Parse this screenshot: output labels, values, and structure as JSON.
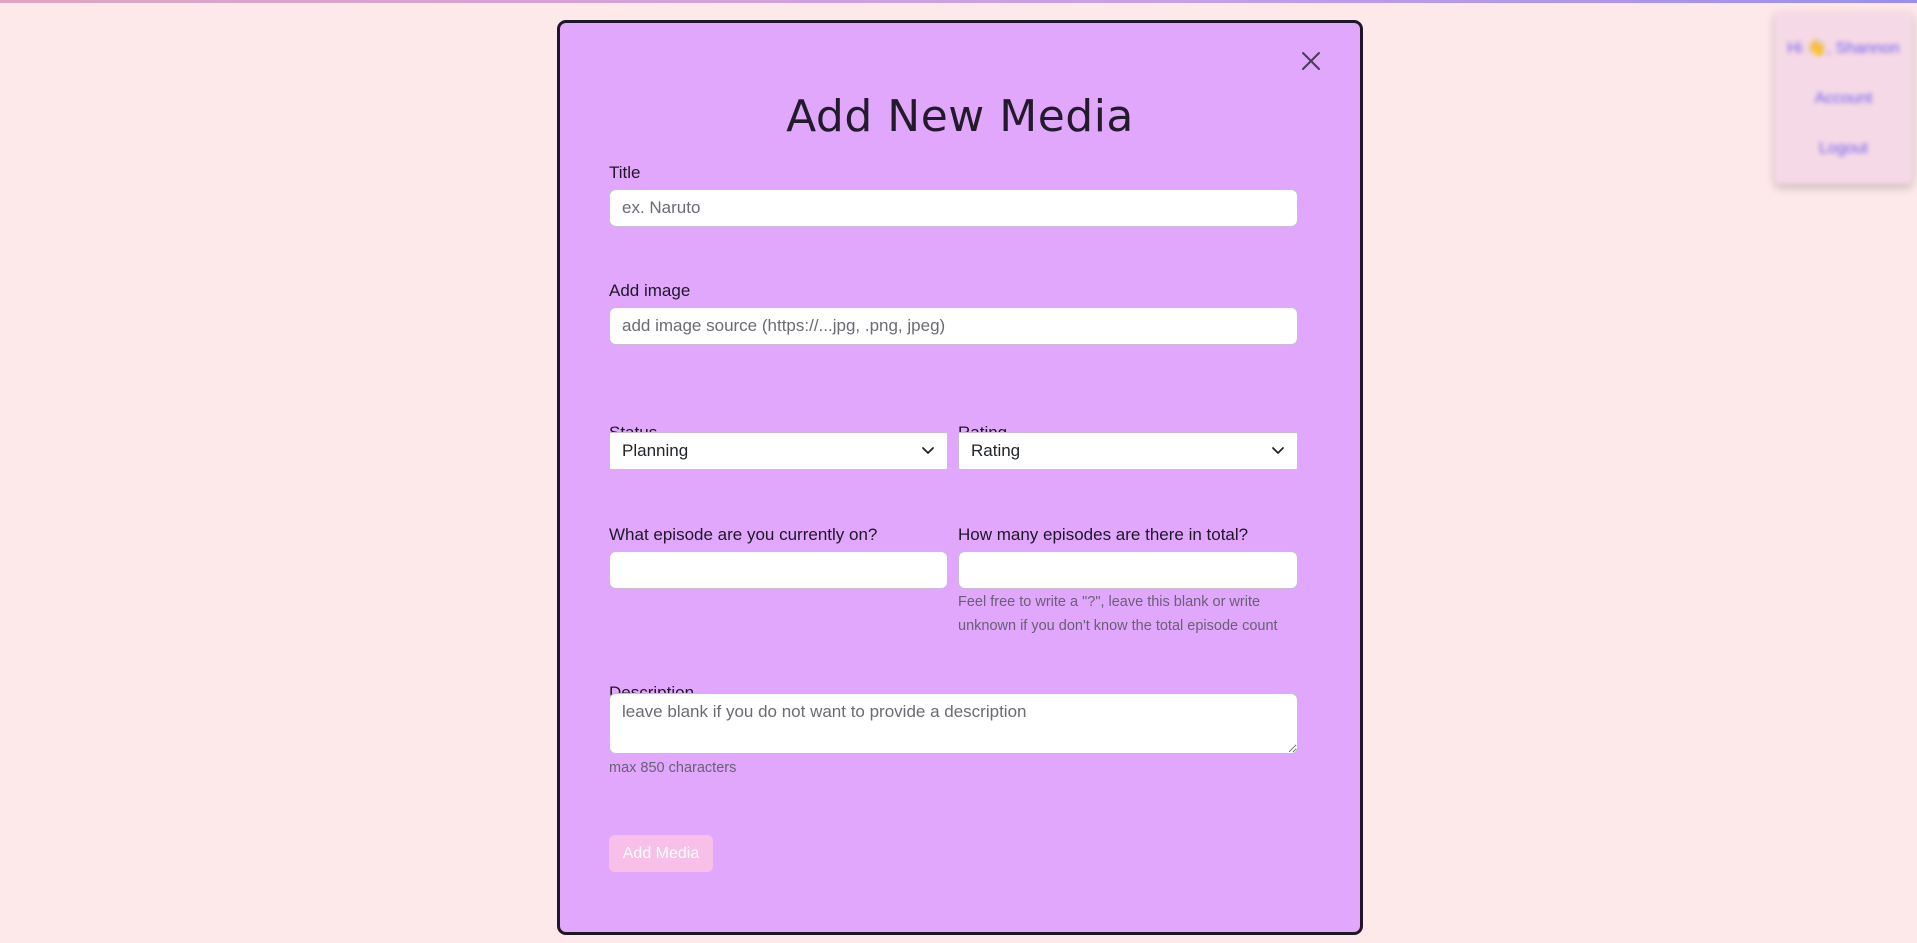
{
  "account_menu": {
    "greeting": "Hi 👋, Shannon",
    "items": [
      "Account",
      "Logout"
    ]
  },
  "modal": {
    "title": "Add New Media",
    "close_icon": "close-icon",
    "fields": {
      "title": {
        "label": "Title",
        "placeholder": "ex. Naruto",
        "value": ""
      },
      "image": {
        "label": "Add image",
        "placeholder": "add image source (https://...jpg, .png, jpeg)",
        "value": ""
      },
      "status": {
        "label": "Status",
        "selected": "Planning",
        "icon": "chevron-down-icon"
      },
      "rating": {
        "label": "Rating",
        "selected": "Rating",
        "icon": "chevron-down-icon"
      },
      "current_episode": {
        "label": "What episode are you currently on?",
        "value": ""
      },
      "total_episodes": {
        "label": "How many episodes are there in total?",
        "value": "",
        "hint_line1": "Feel free to write a \"?\", leave this blank or write",
        "hint_line2": "unknown if you don't know the total episode count"
      },
      "description": {
        "label": "Description",
        "placeholder": "leave blank if you do not want to provide a description",
        "hint": "max 850 characters",
        "value": ""
      }
    },
    "submit_label": "Add Media"
  },
  "colors": {
    "page_background": "#fde8ea",
    "modal_background": "#e1a7fc",
    "modal_border": "#1f1725",
    "submit_button": "#f8bfe9"
  }
}
